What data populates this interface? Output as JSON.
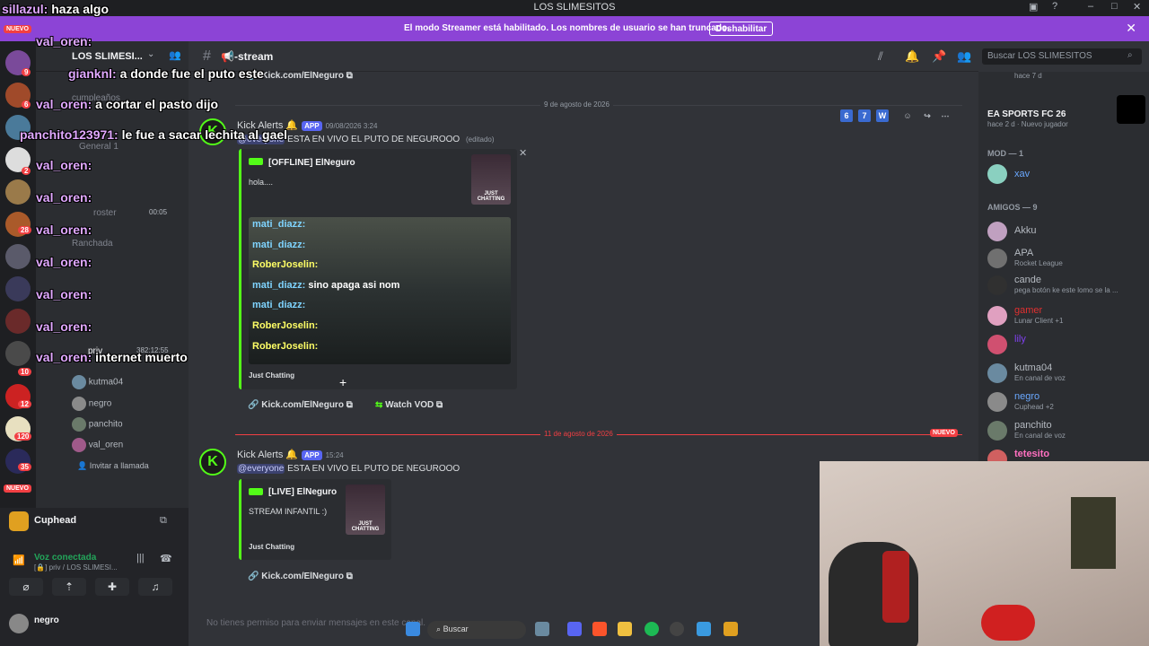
{
  "window": {
    "title": "LOS SLIMESITOS"
  },
  "banner": {
    "text": "El modo Streamer está habilitado. Los nombres de usuario se han truncado.",
    "button": "Deshabilitar"
  },
  "server": {
    "name": "LOS SLIMESI...",
    "search_placeholder": "Buscar LOS SLIMESITOS"
  },
  "channel": {
    "name": "📢-stream"
  },
  "sidebar": {
    "channels": [
      "cumpleaños",
      "General 1",
      "roster",
      "Ranchada",
      "priv"
    ],
    "voice_timer": "00:05",
    "call_timer": "382:12:55",
    "voice_users": [
      {
        "name": "kutma04"
      },
      {
        "name": "negro"
      },
      {
        "name": "panchito"
      },
      {
        "name": "val_oren"
      }
    ],
    "invite": "Invitar a llamada"
  },
  "userpanel": {
    "activity": "Cuphead",
    "voice_status": "Voz conectada",
    "voice_channel": "[🔒] priv / LOS SLIMESI...",
    "username": "negro"
  },
  "guild_badges": [
    "NUEVO",
    "9",
    "6",
    "2",
    "28",
    "10",
    "12",
    "120",
    "35",
    "NUEVO"
  ],
  "messages": {
    "divider1": "9 de agosto de 2026",
    "msg1": {
      "author": "Kick Alerts",
      "tag": "APP",
      "time": "09/08/2026 3:24",
      "mention": "@everyone",
      "text": "ESTA EN VIVO EL PUTO DE NEGUROOO",
      "edited": "(editado)",
      "embed_title": "[OFFLINE] ElNeguro",
      "embed_desc": "hola....",
      "embed_footer": "Just Chatting",
      "thumb_label": "JUST CHATTING",
      "link": "Kick.com/ElNeguro",
      "vod": "Watch VOD"
    },
    "top_link": "Kick.com/ElNeguro",
    "divider2": "11 de agosto de 2026",
    "new_badge": "NUEVO",
    "msg2": {
      "author": "Kick Alerts",
      "tag": "APP",
      "time": "15:24",
      "mention": "@everyone",
      "text": "ESTA EN VIVO EL PUTO DE NEGUROOO",
      "embed_title": "[LIVE] ElNeguro",
      "embed_desc": "STREAM INFANTIL :)",
      "embed_footer": "Just Chatting",
      "thumb_label": "JUST CHATTING",
      "link": "Kick.com/ElNeguro"
    },
    "hover_badges": [
      "6",
      "7",
      "W"
    ],
    "chat_placeholder": "No tienes permiso para enviar mensajes en este canal."
  },
  "embed_image_lines": [
    {
      "name": "mati_diazz:",
      "text": "",
      "color": "#7fd4ff"
    },
    {
      "name": "mati_diazz:",
      "text": "",
      "color": "#7fd4ff"
    },
    {
      "name": "RoberJoselin:",
      "text": "",
      "color": "#ffff66"
    },
    {
      "name": "mati_diazz:",
      "text": "sino apaga asi nom",
      "color": "#7fd4ff"
    },
    {
      "name": "mati_diazz:",
      "text": "",
      "color": "#7fd4ff"
    },
    {
      "name": "RoberJoselin:",
      "text": "",
      "color": "#ffff66"
    },
    {
      "name": "RoberJoselin:",
      "text": "",
      "color": "#ffff66"
    }
  ],
  "members": {
    "top": [
      {
        "name": "hace 7 d",
        "status": ""
      },
      {
        "name": "EA SPORTS FC 26",
        "status": "hace 2 d · Nuevo jugador"
      }
    ],
    "mod_header": "MOD — 1",
    "mods": [
      {
        "name": "xav"
      }
    ],
    "friends_header": "AMIGOS — 9",
    "friends": [
      {
        "name": "Akku",
        "status": ""
      },
      {
        "name": "APA",
        "status": "Rocket League"
      },
      {
        "name": "cande",
        "status": "pega botón ke este lomo se la ..."
      },
      {
        "name": "gamer",
        "status": "Lunar Client +1"
      },
      {
        "name": "lily",
        "status": ""
      },
      {
        "name": "kutma04",
        "status": "En canal de voz"
      },
      {
        "name": "negro",
        "status": "Cuphead +2"
      },
      {
        "name": "panchito",
        "status": "En canal de voz"
      },
      {
        "name": "tetesito",
        "status": ""
      }
    ]
  },
  "taskbar": {
    "search": "Buscar"
  },
  "overlay_chat": [
    {
      "name": "sillazul:",
      "msg": "haza algo"
    },
    {
      "name": "val_oren:",
      "msg": ""
    },
    {
      "name": "gianknl:",
      "msg": "a donde fue el puto este"
    },
    {
      "name": "val_oren:",
      "msg": "a cortar el pasto dijo"
    },
    {
      "name": "panchito123971:",
      "msg": "le fue a sacar lechita al gael"
    },
    {
      "name": "val_oren:",
      "msg": ""
    },
    {
      "name": "val_oren:",
      "msg": ""
    },
    {
      "name": "val_oren:",
      "msg": ""
    },
    {
      "name": "val_oren:",
      "msg": ""
    },
    {
      "name": "val_oren:",
      "msg": ""
    },
    {
      "name": "val_oren:",
      "msg": ""
    },
    {
      "name": "val_oren:",
      "msg": "internet muerto"
    }
  ]
}
